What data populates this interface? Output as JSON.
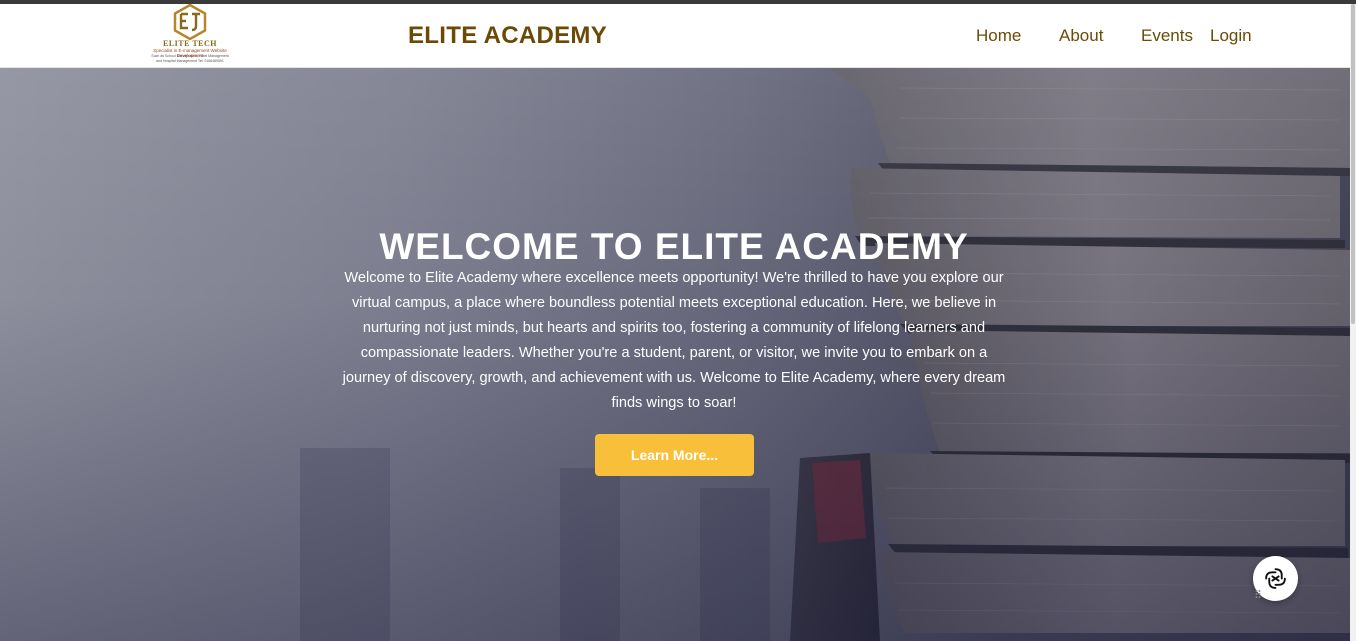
{
  "navbar": {
    "logo": {
      "name": "ELITE TECH",
      "tagline": "Specialist in E-management Website Development",
      "subline": "Such as School Management, Hotel Management and Hospital Management Tel: 0166489591"
    },
    "brand": "ELITE ACADEMY",
    "links": [
      {
        "label": "Home"
      },
      {
        "label": "About"
      },
      {
        "label": "Events"
      },
      {
        "label": "Login"
      }
    ]
  },
  "hero": {
    "title": "WELCOME TO ELITE ACADEMY",
    "text": "Welcome to Elite Academy where excellence meets opportunity! We're thrilled to have you explore our virtual campus, a place where boundless potential meets exceptional education. Here, we believe in nurturing not just minds, but hearts and spirits too, fostering a community of lifelong learners and compassionate leaders. Whether you're a student, parent, or visitor, we invite you to embark on a journey of discovery, growth, and achievement with us. Welcome to Elite Academy, where every dream finds wings to soar!",
    "button_label": "Learn More..."
  },
  "colors": {
    "brand": "#6b4a06",
    "button": "#f8c03a",
    "hero_text": "#ffffff"
  },
  "icons": {
    "chat": "chat-assistant-icon"
  }
}
